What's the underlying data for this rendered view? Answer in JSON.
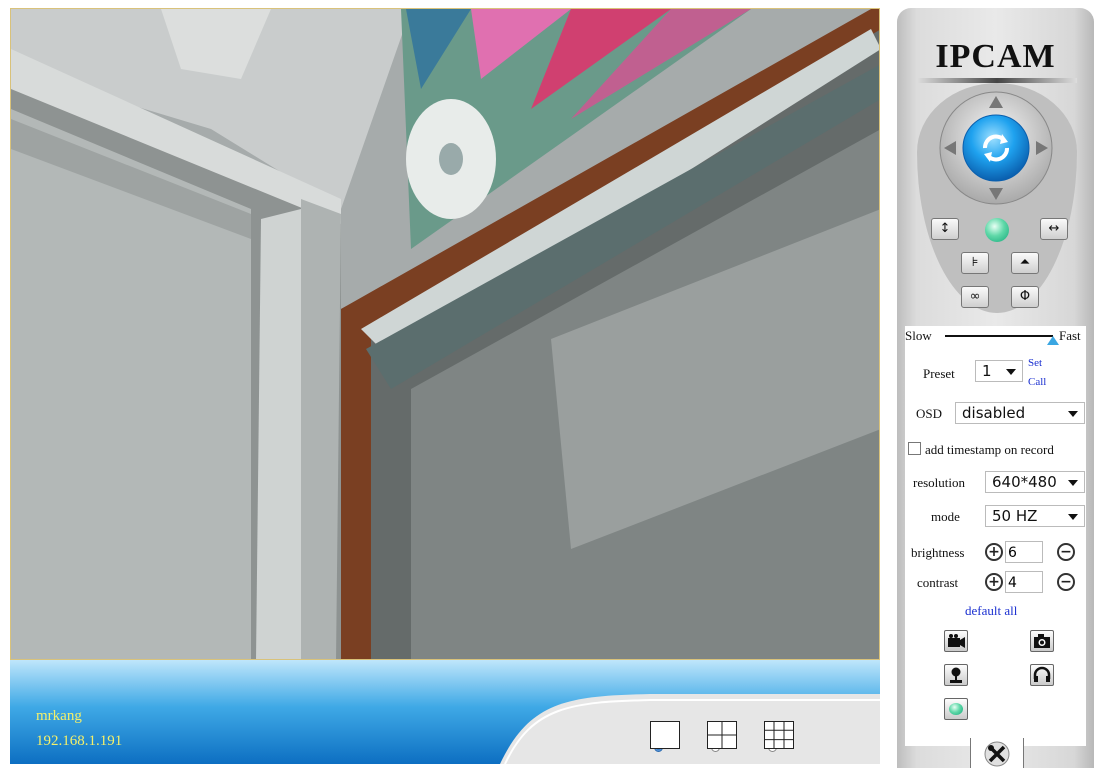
{
  "panel": {
    "logo": "IPCAM",
    "speed": {
      "slow_label": "Slow",
      "fast_label": "Fast",
      "level": 1.0
    },
    "preset": {
      "label": "Preset",
      "value": "1",
      "set_link": "Set",
      "call_link": "Call"
    },
    "osd": {
      "label": "OSD",
      "value": "disabled"
    },
    "timestamp": {
      "label": "add timestamp on record",
      "checked": false
    },
    "resolution": {
      "label": "resolution",
      "value": "640*480"
    },
    "mode": {
      "label": "mode",
      "value": "50 HZ"
    },
    "brightness": {
      "label": "brightness",
      "value": "6"
    },
    "contrast": {
      "label": "contrast",
      "value": "4"
    },
    "default_all": "default all",
    "icons": [
      "up-arrow-icon",
      "down-arrow-icon",
      "left-arrow-icon",
      "right-arrow-icon",
      "center-refresh-icon",
      "vertical-patrol-icon",
      "horizontal-patrol-icon",
      "flip-icon",
      "mirror-icon",
      "infinite-icon",
      "io-icon",
      "record-video-icon",
      "snapshot-icon",
      "talk-icon",
      "listen-icon",
      "settings-tools-icon"
    ]
  },
  "footer": {
    "camera_name": "mrkang",
    "camera_ip": "192.168.1.191",
    "layouts": [
      {
        "name": "1-view",
        "selected": true
      },
      {
        "name": "4-view",
        "selected": false
      },
      {
        "name": "9-view",
        "selected": false
      }
    ]
  },
  "colors": {
    "accent_blue": "#1f8fd6",
    "name_text": "#f4f06a",
    "link_blue": "#1a2fd0",
    "green": "#15a87a"
  }
}
